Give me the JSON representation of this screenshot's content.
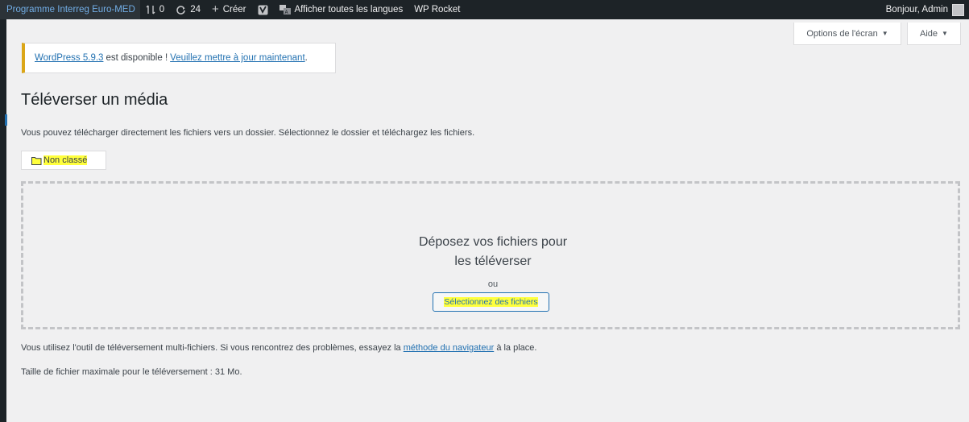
{
  "adminbar": {
    "site_name": "Programme Interreg Euro-MED",
    "revisions_count": "0",
    "updates_count": "24",
    "create_label": "Créer",
    "languages_label": "Afficher toutes les langues",
    "wp_rocket_label": "WP Rocket",
    "greeting": "Bonjour, Admin",
    "icons": [
      "revisions-icon",
      "updates-icon",
      "plus-icon",
      "yoast-icon",
      "translate-icon"
    ]
  },
  "screen_meta": {
    "options_label": "Options de l'écran",
    "help_label": "Aide"
  },
  "notice": {
    "version_link": "WordPress 5.9.3",
    "middle_text": "est disponible !",
    "update_link": "Veuillez mettre à jour maintenant",
    "end_text": "."
  },
  "page": {
    "title": "Téléverser un média",
    "description": "Vous pouvez télécharger directement les fichiers vers un dossier. Sélectionnez le dossier et téléchargez les fichiers.",
    "folder_label": "Non classé"
  },
  "dropzone": {
    "title_line1": "Déposez vos fichiers pour",
    "title_line2": "les téléverser",
    "or_label": "ou",
    "select_button": "Sélectionnez des fichiers"
  },
  "footer_info": {
    "multi_uploader_text": "Vous utilisez l'outil de téléversement multi-fichiers. Si vous rencontrez des problèmes, essayez la",
    "browser_method_link": "méthode du navigateur",
    "multi_uploader_end": "à la place.",
    "max_size_text": "Taille de fichier maximale pour le téléversement : 31 Mo."
  },
  "colors": {
    "adminbar_bg": "#1d2327",
    "link": "#2271b1",
    "notice_border": "#dba617",
    "highlight": "#ffff3c"
  }
}
